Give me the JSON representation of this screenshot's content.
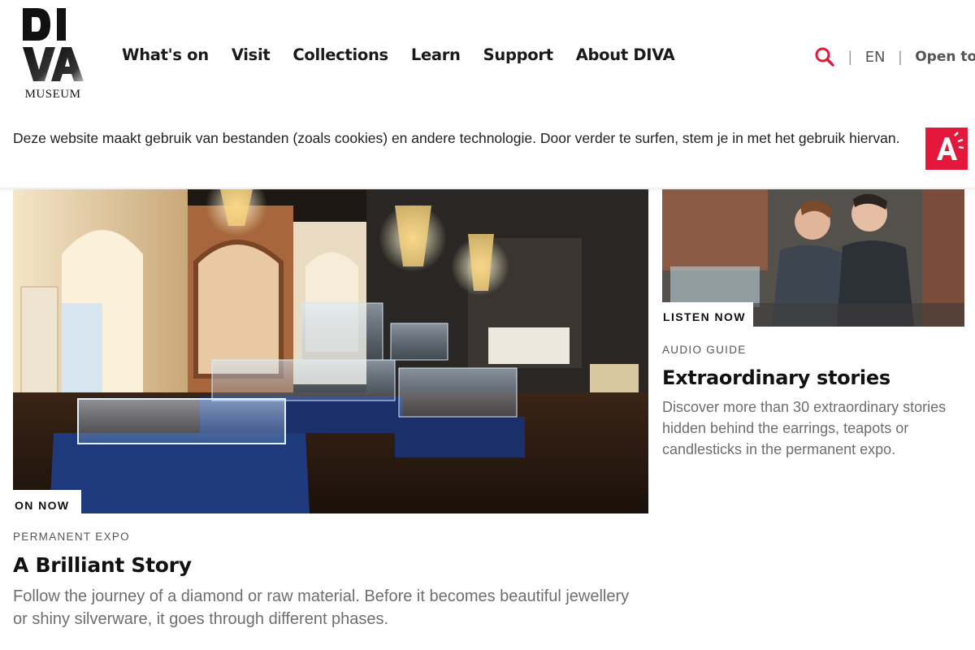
{
  "brand": {
    "logo_text": "MUSEUM",
    "logo_letters": [
      "D",
      "I",
      "V",
      "A"
    ]
  },
  "nav": {
    "items": [
      "What's on",
      "Visit",
      "Collections",
      "Learn",
      "Support",
      "About DIVA"
    ]
  },
  "utils": {
    "search_icon": "search-icon",
    "separator": "|",
    "language": "EN",
    "open_today": "Open tod"
  },
  "cookie_banner": {
    "text": "Deze website maakt gebruik van bestanden (zoals cookies) en andere technologie. Door verder te surfen, stem je in met het gebruik hiervan.",
    "city_logo_letter": "A"
  },
  "hero_card": {
    "tag": "ON NOW",
    "category": "PERMANENT EXPO",
    "title": "A Brilliant Story",
    "description": "Follow the journey of a diamond or raw material. Before it becomes beautiful jewellery or shiny silverware, it goes through different phases."
  },
  "side_card": {
    "tag": "LISTEN NOW",
    "category": "AUDIO GUIDE",
    "title": "Extraordinary stories",
    "description": "Discover more than 30 extraordinary stories hidden behind the earrings, teapots or candlesticks in the permanent expo."
  },
  "colors": {
    "accent_red": "#e3183a",
    "text_dark": "#111111",
    "text_muted": "#6e6e6e"
  }
}
